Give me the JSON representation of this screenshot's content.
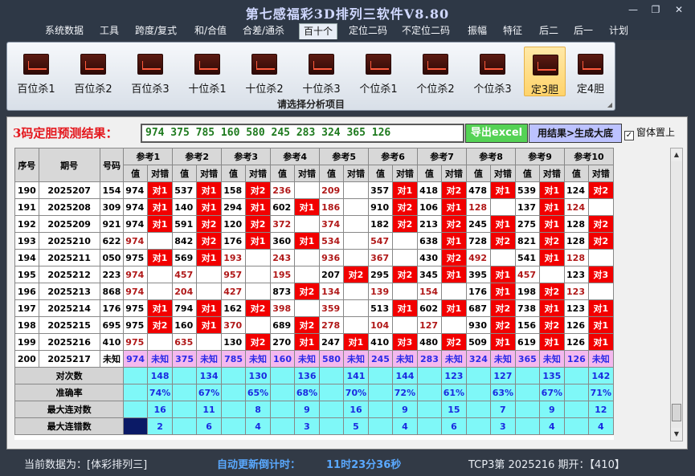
{
  "window": {
    "title": "第七感福彩3D排列三软件V8.80",
    "min": "—",
    "max": "❐",
    "close": "✕"
  },
  "menu": [
    "系统数据",
    "工具",
    "跨度/复式",
    "和/合值",
    "合差/通杀",
    "百十个",
    "定位二码",
    "不定位二码",
    "振幅",
    "特征",
    "后二",
    "后一",
    "计划"
  ],
  "tools": [
    "百位杀1",
    "百位杀2",
    "百位杀3",
    "十位杀1",
    "十位杀2",
    "十位杀3",
    "个位杀1",
    "个位杀2",
    "个位杀3",
    "定3胆",
    "定4胆"
  ],
  "ribbon_caption": "请选择分析项目",
  "prediction": {
    "label": "3码定胆预测结果：",
    "value": "974 375 785 160 580 245 283 324 365 126",
    "export_btn": "导出excel",
    "generate_btn": "用结果>生成大底",
    "ontop_label": "窗体置上",
    "ontop_checked": "✓"
  },
  "grid": {
    "headers": {
      "seq": "序号",
      "issue": "期号",
      "code": "号码",
      "value": "值",
      "check": "对错"
    },
    "refs": [
      "参考1",
      "参考2",
      "参考3",
      "参考4",
      "参考5",
      "参考6",
      "参考7",
      "参考8",
      "参考9",
      "参考10"
    ],
    "rows": [
      {
        "s": "190",
        "i": "2025207",
        "c": "154",
        "r": [
          [
            "974",
            "对1"
          ],
          [
            "537",
            "对1"
          ],
          [
            "158",
            "对2"
          ],
          [
            "236",
            ""
          ],
          [
            "209",
            ""
          ],
          [
            "357",
            "对1"
          ],
          [
            "418",
            "对2"
          ],
          [
            "478",
            "对1"
          ],
          [
            "539",
            "对1"
          ],
          [
            "124",
            "对2"
          ]
        ]
      },
      {
        "s": "191",
        "i": "2025208",
        "c": "309",
        "r": [
          [
            "974",
            "对1"
          ],
          [
            "140",
            "对1"
          ],
          [
            "294",
            "对1"
          ],
          [
            "602",
            "对1"
          ],
          [
            "186",
            ""
          ],
          [
            "910",
            "对2"
          ],
          [
            "106",
            "对1"
          ],
          [
            "128",
            ""
          ],
          [
            "137",
            "对1"
          ],
          [
            "124",
            ""
          ]
        ]
      },
      {
        "s": "192",
        "i": "2025209",
        "c": "921",
        "r": [
          [
            "974",
            "对1"
          ],
          [
            "591",
            "对2"
          ],
          [
            "120",
            "对2"
          ],
          [
            "372",
            ""
          ],
          [
            "374",
            ""
          ],
          [
            "182",
            "对2"
          ],
          [
            "213",
            "对2"
          ],
          [
            "245",
            "对1"
          ],
          [
            "275",
            "对1"
          ],
          [
            "128",
            "对2"
          ]
        ]
      },
      {
        "s": "193",
        "i": "2025210",
        "c": "622",
        "r": [
          [
            "974",
            ""
          ],
          [
            "842",
            "对2"
          ],
          [
            "176",
            "对1"
          ],
          [
            "360",
            "对1"
          ],
          [
            "534",
            ""
          ],
          [
            "547",
            ""
          ],
          [
            "638",
            "对1"
          ],
          [
            "728",
            "对2"
          ],
          [
            "821",
            "对2"
          ],
          [
            "128",
            "对2"
          ]
        ]
      },
      {
        "s": "194",
        "i": "2025211",
        "c": "050",
        "r": [
          [
            "975",
            "对1"
          ],
          [
            "569",
            "对1"
          ],
          [
            "193",
            ""
          ],
          [
            "243",
            ""
          ],
          [
            "936",
            ""
          ],
          [
            "367",
            ""
          ],
          [
            "430",
            "对2"
          ],
          [
            "492",
            ""
          ],
          [
            "541",
            "对1"
          ],
          [
            "128",
            ""
          ]
        ]
      },
      {
        "s": "195",
        "i": "2025212",
        "c": "223",
        "r": [
          [
            "974",
            ""
          ],
          [
            "457",
            ""
          ],
          [
            "957",
            ""
          ],
          [
            "195",
            ""
          ],
          [
            "207",
            "对2"
          ],
          [
            "295",
            "对2"
          ],
          [
            "345",
            "对1"
          ],
          [
            "395",
            "对1"
          ],
          [
            "457",
            ""
          ],
          [
            "123",
            "对3"
          ]
        ]
      },
      {
        "s": "196",
        "i": "2025213",
        "c": "868",
        "r": [
          [
            "974",
            ""
          ],
          [
            "204",
            ""
          ],
          [
            "427",
            ""
          ],
          [
            "873",
            "对2"
          ],
          [
            "134",
            ""
          ],
          [
            "139",
            ""
          ],
          [
            "154",
            ""
          ],
          [
            "176",
            "对1"
          ],
          [
            "198",
            "对2"
          ],
          [
            "123",
            ""
          ]
        ]
      },
      {
        "s": "197",
        "i": "2025214",
        "c": "176",
        "r": [
          [
            "975",
            "对1"
          ],
          [
            "794",
            "对1"
          ],
          [
            "162",
            "对2"
          ],
          [
            "398",
            ""
          ],
          [
            "359",
            ""
          ],
          [
            "513",
            "对1"
          ],
          [
            "602",
            "对1"
          ],
          [
            "687",
            "对2"
          ],
          [
            "738",
            "对1"
          ],
          [
            "123",
            "对1"
          ]
        ]
      },
      {
        "s": "198",
        "i": "2025215",
        "c": "695",
        "r": [
          [
            "975",
            "对2"
          ],
          [
            "160",
            "对1"
          ],
          [
            "370",
            ""
          ],
          [
            "689",
            "对2"
          ],
          [
            "278",
            ""
          ],
          [
            "104",
            ""
          ],
          [
            "127",
            ""
          ],
          [
            "930",
            "对2"
          ],
          [
            "156",
            "对2"
          ],
          [
            "126",
            "对1"
          ]
        ]
      },
      {
        "s": "199",
        "i": "2025216",
        "c": "410",
        "r": [
          [
            "975",
            ""
          ],
          [
            "635",
            ""
          ],
          [
            "130",
            "对2"
          ],
          [
            "270",
            "对1"
          ],
          [
            "247",
            "对1"
          ],
          [
            "410",
            "对3"
          ],
          [
            "480",
            "对2"
          ],
          [
            "509",
            "对1"
          ],
          [
            "619",
            "对1"
          ],
          [
            "126",
            "对1"
          ]
        ]
      }
    ],
    "last": {
      "s": "200",
      "i": "2025217",
      "c": "未知",
      "r": [
        [
          "974",
          "未知"
        ],
        [
          "375",
          "未知"
        ],
        [
          "785",
          "未知"
        ],
        [
          "160",
          "未知"
        ],
        [
          "580",
          "未知"
        ],
        [
          "245",
          "未知"
        ],
        [
          "283",
          "未知"
        ],
        [
          "324",
          "未知"
        ],
        [
          "365",
          "未知"
        ],
        [
          "126",
          "未知"
        ]
      ]
    },
    "stats": [
      {
        "label": "对次数",
        "vals": [
          "148",
          "134",
          "130",
          "136",
          "141",
          "144",
          "123",
          "127",
          "135",
          "142"
        ]
      },
      {
        "label": "准确率",
        "vals": [
          "74%",
          "67%",
          "65%",
          "68%",
          "70%",
          "72%",
          "61%",
          "63%",
          "67%",
          "71%"
        ]
      },
      {
        "label": "最大连对数",
        "vals": [
          "16",
          "11",
          "8",
          "9",
          "16",
          "9",
          "15",
          "7",
          "9",
          "12"
        ]
      },
      {
        "label": "最大连错数",
        "vals": [
          "2",
          "6",
          "4",
          "3",
          "5",
          "4",
          "6",
          "3",
          "4",
          "4"
        ]
      }
    ]
  },
  "status": {
    "current_data": "当前数据为：[体彩排列三]",
    "countdown_label": "自动更新倒计时：",
    "countdown": "11时23分36秒",
    "last_draw": "TCP3第 2025216 期开：【410】"
  },
  "colors": {
    "hit": "#f20000",
    "stat_bg": "#7ff8f8",
    "last_row_bg": "#f4b8ee",
    "brand_title": "#d0d8ff"
  }
}
